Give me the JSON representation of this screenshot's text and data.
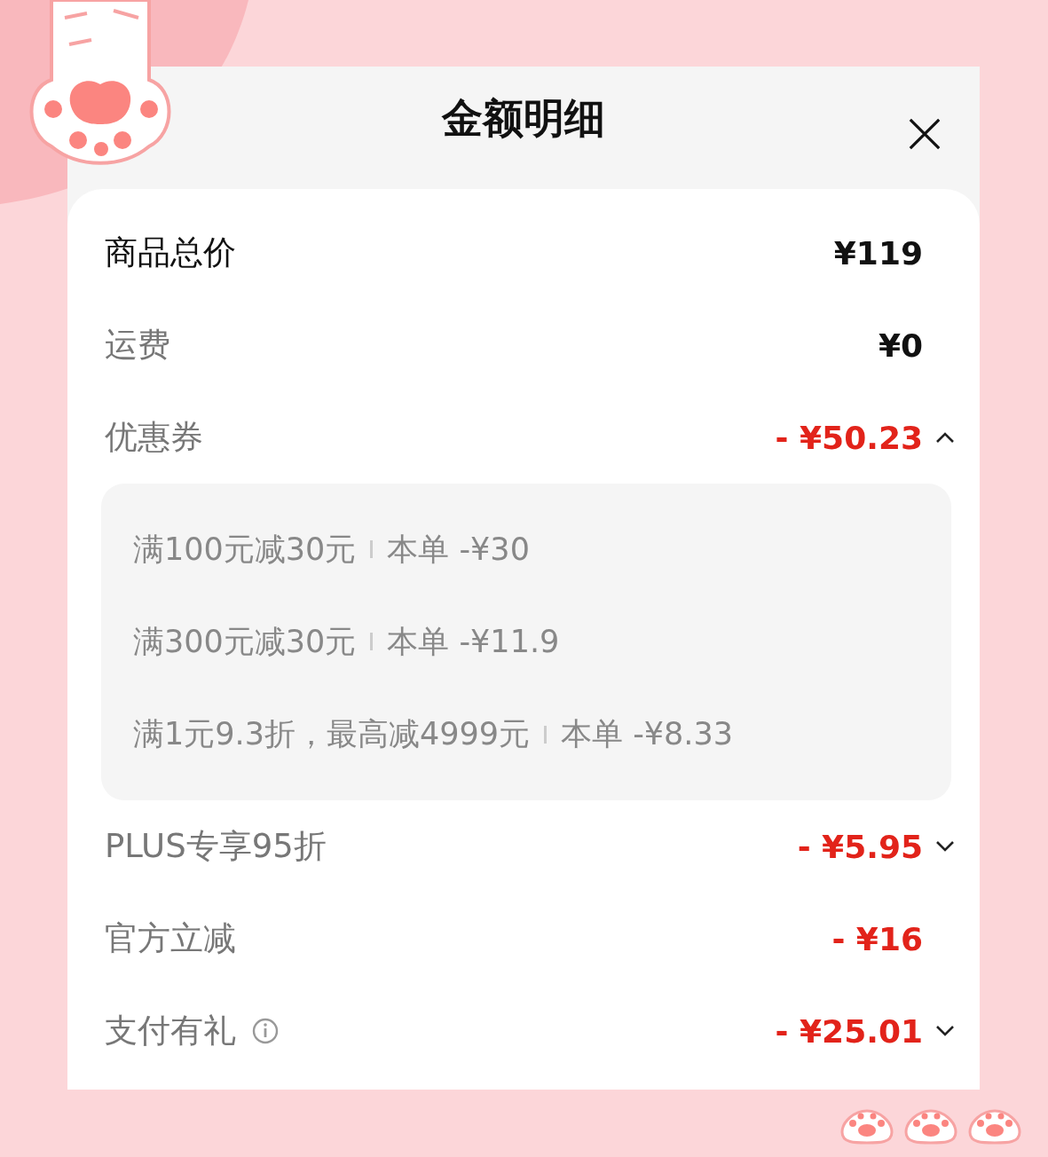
{
  "title": "金额明细",
  "rows": [
    {
      "kind": "total",
      "label": "商品总价",
      "value": "¥119"
    },
    {
      "kind": "fee",
      "label": "运费",
      "value": "¥0"
    },
    {
      "kind": "discount",
      "label": "优惠券",
      "value": "- ¥50.23",
      "expanded": true,
      "details": [
        {
          "condition": "满100元减30元",
          "amount": "本单 -¥30"
        },
        {
          "condition": "满300元减30元",
          "amount": "本单 -¥11.9"
        },
        {
          "condition": "满1元9.3折，最高减4999元",
          "amount": "本单 -¥8.33"
        }
      ]
    },
    {
      "kind": "discount",
      "label": "PLUS专享95折",
      "value": "- ¥5.95",
      "expanded": false
    },
    {
      "kind": "discount",
      "label": "官方立减",
      "value": "- ¥16"
    },
    {
      "kind": "discount",
      "label": "支付有礼",
      "value": "- ¥25.01",
      "expanded": false,
      "info": true
    }
  ]
}
